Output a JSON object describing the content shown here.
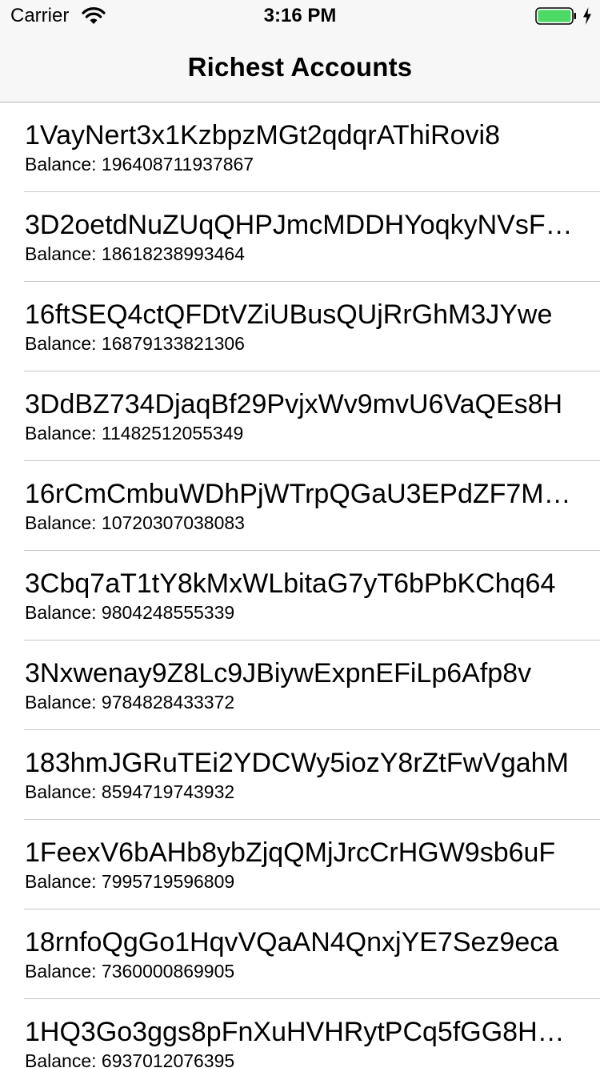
{
  "status_bar": {
    "carrier": "Carrier",
    "time": "3:16 PM",
    "battery_color": "#4cd964"
  },
  "nav": {
    "title": "Richest Accounts"
  },
  "accounts": [
    {
      "address": "1VayNert3x1KzbpzMGt2qdqrAThiRovi8",
      "balance": "Balance: 196408711937867"
    },
    {
      "address": "3D2oetdNuZUqQHPJmcMDDHYoqkyNVsF…",
      "balance": "Balance: 18618238993464"
    },
    {
      "address": "16ftSEQ4ctQFDtVZiUBusQUjRrGhM3JYwe",
      "balance": "Balance: 16879133821306"
    },
    {
      "address": "3DdBZ734DjaqBf29PvjxWv9mvU6VaQEs8H",
      "balance": "Balance: 11482512055349"
    },
    {
      "address": "16rCmCmbuWDhPjWTrpQGaU3EPdZF7MT…",
      "balance": "Balance: 10720307038083"
    },
    {
      "address": "3Cbq7aT1tY8kMxWLbitaG7yT6bPbKChq64",
      "balance": "Balance: 9804248555339"
    },
    {
      "address": "3Nxwenay9Z8Lc9JBiywExpnEFiLp6Afp8v",
      "balance": "Balance: 9784828433372"
    },
    {
      "address": "183hmJGRuTEi2YDCWy5iozY8rZtFwVgahM",
      "balance": "Balance: 8594719743932"
    },
    {
      "address": "1FeexV6bAHb8ybZjqQMjJrcCrHGW9sb6uF",
      "balance": "Balance: 7995719596809"
    },
    {
      "address": "18rnfoQgGo1HqvVQaAN4QnxjYE7Sez9eca",
      "balance": "Balance: 7360000869905"
    },
    {
      "address": "1HQ3Go3ggs8pFnXuHVHRytPCq5fGG8Hb…",
      "balance": "Balance: 6937012076395"
    }
  ]
}
